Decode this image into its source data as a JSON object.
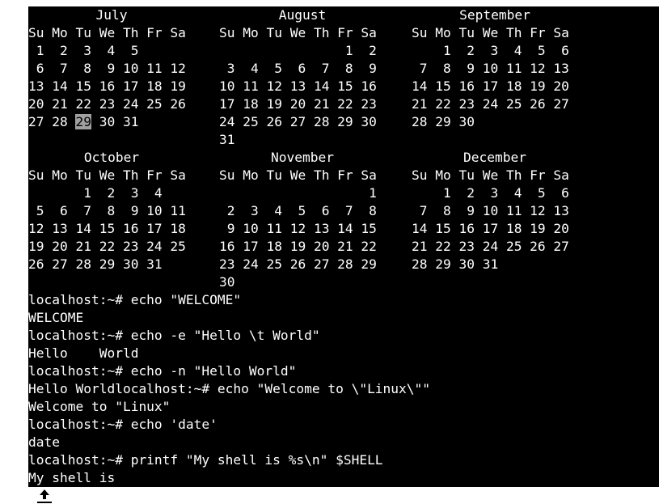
{
  "calendar": {
    "months": [
      {
        "name": "July",
        "rows": [
          " 1  2  3  4  5",
          "6  7  8  9 10 11 12",
          "13 14 15 16 17 18 19",
          "20 21 22 23 24 25 26",
          "27 28 29 30 31"
        ]
      },
      {
        "name": "August",
        "rows": [
          "                1  2",
          "3  4  5  6  7  8  9",
          "10 11 12 13 14 15 16",
          "17 18 19 20 21 22 23",
          "24 25 26 27 28 29 30",
          "31"
        ]
      },
      {
        "name": "September",
        "rows": [
          "    1  2  3  4  5  6",
          "7  8  9 10 11 12 13",
          "14 15 16 17 18 19 20",
          "21 22 23 24 25 26 27",
          "28 29 30"
        ]
      },
      {
        "name": "October",
        "rows": [
          "       1  2  3  4",
          "5  6  7  8  9 10 11",
          "12 13 14 15 16 17 18",
          "19 20 21 22 23 24 25",
          "26 27 28 29 30 31"
        ]
      },
      {
        "name": "November",
        "rows": [
          "                   1",
          "2  3  4  5  6  7  8",
          "9 10 11 12 13 14 15",
          "16 17 18 19 20 21 22",
          "23 24 25 26 27 28 29",
          "30"
        ]
      },
      {
        "name": "December",
        "rows": [
          "    1  2  3  4  5  6",
          "7  8  9 10 11 12 13",
          "14 15 16 17 18 19 20",
          "21 22 23 24 25 26 27",
          "28 29 30 31"
        ]
      }
    ],
    "weekday_header": "Su Mo Tu We Th Fr Sa",
    "highlighted_day": "29"
  },
  "session": {
    "lines": [
      "localhost:~# echo \"WELCOME\"",
      "WELCOME",
      "localhost:~# echo -e \"Hello \\t World\"",
      "Hello    World",
      "localhost:~# echo -n \"Hello World\"",
      "Hello Worldlocalhost:~# echo \"Welcome to \\\"Linux\\\"\"",
      "Welcome to \"Linux\"",
      "localhost:~# echo 'date'",
      "date",
      "localhost:~# printf \"My shell is %s\\n\" $SHELL",
      "My shell is"
    ]
  },
  "colors": {
    "background": "#000000",
    "text": "#ffffff",
    "highlight_bg": "#a0a0a0"
  },
  "cursor_icon": "mouse-pointer-icon"
}
